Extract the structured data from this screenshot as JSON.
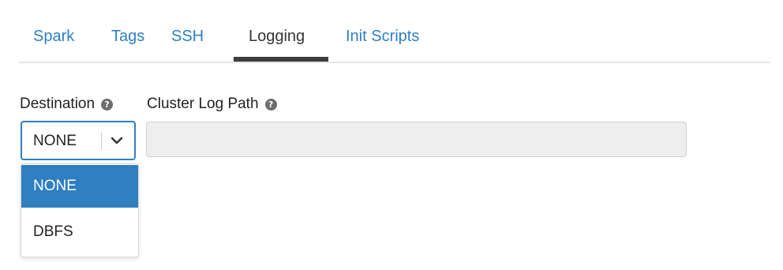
{
  "tabs": [
    {
      "label": "Spark",
      "active": false
    },
    {
      "label": "Tags",
      "active": false
    },
    {
      "label": "SSH",
      "active": false
    },
    {
      "label": "Logging",
      "active": true
    },
    {
      "label": "Init Scripts",
      "active": false
    }
  ],
  "destination": {
    "label": "Destination",
    "help_icon": "question-circle-icon",
    "selected": "NONE",
    "options": [
      "NONE",
      "DBFS"
    ]
  },
  "cluster_log_path": {
    "label": "Cluster Log Path",
    "help_icon": "question-circle-icon",
    "value": "",
    "placeholder": ""
  },
  "colors": {
    "accent": "#2f7fc1",
    "active_tab_underline": "#3d3d3d",
    "input_disabled_bg": "#eeeeee"
  }
}
